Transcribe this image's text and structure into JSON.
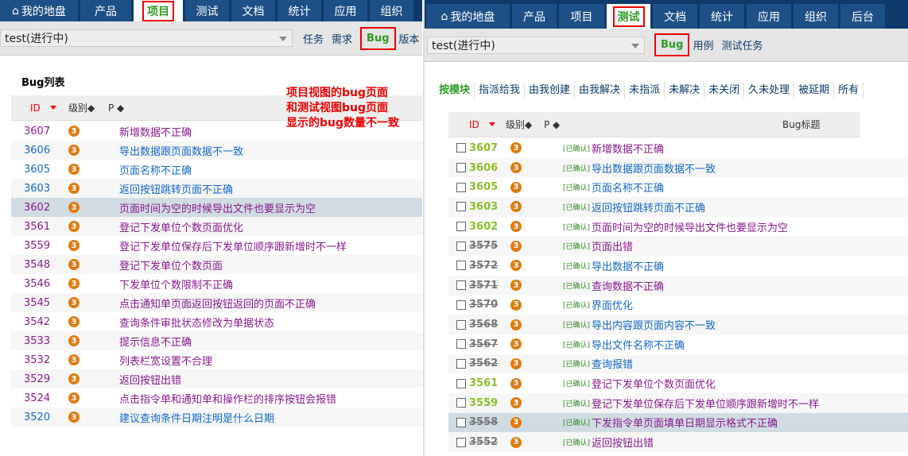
{
  "left": {
    "nav": [
      "我的地盘",
      "产品",
      "项目",
      "测试",
      "文档",
      "统计",
      "应用",
      "组织"
    ],
    "active_tab": 2,
    "project_select": "test(进行中)",
    "sublinks": [
      "任务",
      "需求",
      "Bug",
      "版本"
    ],
    "active_sublink": 2,
    "list_title": "Bug列表",
    "annotation": [
      "项目视图的bug页面",
      "和测试视图bug页面",
      "显示的bug数量不一致"
    ],
    "headers": {
      "id": "ID",
      "severity": "级别◆",
      "priority": "P ◆"
    },
    "rows": [
      {
        "id": "3607",
        "sev": "3",
        "title": "新增数据不正确",
        "c": "purple"
      },
      {
        "id": "3606",
        "sev": "3",
        "title": "导出数据跟页面数据不一致",
        "c": "blue"
      },
      {
        "id": "3605",
        "sev": "3",
        "title": "页面名称不正确",
        "c": "blue"
      },
      {
        "id": "3603",
        "sev": "3",
        "title": "返回按钮跳转页面不正确",
        "c": "blue"
      },
      {
        "id": "3602",
        "sev": "3",
        "title": "页面时间为空的时候导出文件也要显示为空",
        "c": "purple"
      },
      {
        "id": "3561",
        "sev": "3",
        "title": "登记下发单位个数页面优化",
        "c": "purple"
      },
      {
        "id": "3559",
        "sev": "3",
        "title": "登记下发单位保存后下发单位顺序跟新增时不一样",
        "c": "purple"
      },
      {
        "id": "3548",
        "sev": "3",
        "title": "登记下发单位个数页面",
        "c": "purple"
      },
      {
        "id": "3546",
        "sev": "3",
        "title": "下发单位个数限制不正确",
        "c": "purple"
      },
      {
        "id": "3545",
        "sev": "3",
        "title": "点击通知单页面返回按钮返回的页面不正确",
        "c": "purple"
      },
      {
        "id": "3542",
        "sev": "3",
        "title": "查询条件审批状态修改为单据状态",
        "c": "purple"
      },
      {
        "id": "3533",
        "sev": "3",
        "title": "提示信息不正确",
        "c": "purple"
      },
      {
        "id": "3532",
        "sev": "3",
        "title": "列表栏宽设置不合理",
        "c": "purple"
      },
      {
        "id": "3529",
        "sev": "3",
        "title": "返回按钮出错",
        "c": "purple"
      },
      {
        "id": "3524",
        "sev": "3",
        "title": "点击指令单和通知单和操作栏的排序按钮会报错",
        "c": "purple"
      },
      {
        "id": "3520",
        "sev": "3",
        "title": "建议查询条件日期注明是什么日期",
        "c": "blue"
      }
    ]
  },
  "right": {
    "nav": [
      "我的地盘",
      "产品",
      "项目",
      "测试",
      "文档",
      "统计",
      "应用",
      "组织",
      "后台"
    ],
    "active_tab": 3,
    "project_select": "test(进行中)",
    "sublinks": [
      "Bug",
      "用例",
      "测试任务"
    ],
    "active_sublink": 0,
    "filters": [
      "按模块",
      "指派给我",
      "由我创建",
      "由我解决",
      "未指派",
      "未解决",
      "未关闭",
      "久未处理",
      "被延期",
      "所有"
    ],
    "headers": {
      "id": "ID",
      "severity": "级别◆",
      "priority": "P ◆",
      "title": "Bug标题"
    },
    "status_tag": "[已确认]",
    "rows": [
      {
        "id": "3607",
        "sev": "3",
        "title": "新增数据不正确",
        "c": "purple",
        "closed": false
      },
      {
        "id": "3606",
        "sev": "3",
        "title": "导出数据跟页面数据不一致",
        "c": "blue",
        "closed": false
      },
      {
        "id": "3605",
        "sev": "3",
        "title": "页面名称不正确",
        "c": "blue",
        "closed": false
      },
      {
        "id": "3603",
        "sev": "3",
        "title": "返回按钮跳转页面不正确",
        "c": "blue",
        "closed": false
      },
      {
        "id": "3602",
        "sev": "3",
        "title": "页面时间为空的时候导出文件也要显示为空",
        "c": "purple",
        "closed": false
      },
      {
        "id": "3575",
        "sev": "3",
        "title": "页面出错",
        "c": "purple",
        "closed": true
      },
      {
        "id": "3572",
        "sev": "3",
        "title": "导出数据不正确",
        "c": "blue",
        "closed": true
      },
      {
        "id": "3571",
        "sev": "3",
        "title": "查询数据不正确",
        "c": "purple",
        "closed": true
      },
      {
        "id": "3570",
        "sev": "3",
        "title": "界面优化",
        "c": "blue",
        "closed": true
      },
      {
        "id": "3568",
        "sev": "3",
        "title": "导出内容跟页面内容不一致",
        "c": "blue",
        "closed": true
      },
      {
        "id": "3567",
        "sev": "3",
        "title": "导出文件名称不正确",
        "c": "blue",
        "closed": true
      },
      {
        "id": "3562",
        "sev": "3",
        "title": "查询报错",
        "c": "blue",
        "closed": true
      },
      {
        "id": "3561",
        "sev": "3",
        "title": "登记下发单位个数页面优化",
        "c": "purple",
        "closed": false
      },
      {
        "id": "3559",
        "sev": "3",
        "title": "登记下发单位保存后下发单位顺序跟新增时不一样",
        "c": "purple",
        "closed": false
      },
      {
        "id": "3558",
        "sev": "3",
        "title": "下发指令单页面填单日期显示格式不正确",
        "c": "purple",
        "closed": true
      },
      {
        "id": "3552",
        "sev": "3",
        "title": "返回按钮出错",
        "c": "purple",
        "closed": true
      }
    ]
  }
}
